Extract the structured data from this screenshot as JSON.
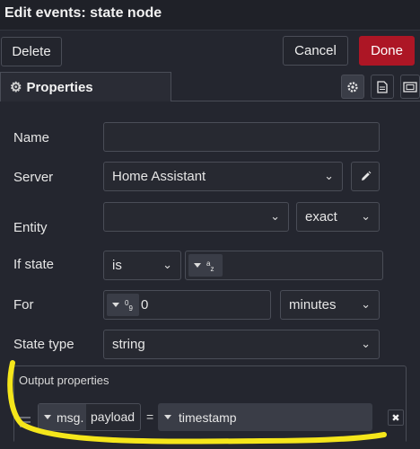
{
  "dialog": {
    "title": "Edit events: state node"
  },
  "actions": {
    "delete_label": "Delete",
    "cancel_label": "Cancel",
    "done_label": "Done",
    "done_color": "#ad1625"
  },
  "tabs": {
    "properties_label": "Properties",
    "icons": [
      "gear-icon",
      "document-icon",
      "frame-icon"
    ]
  },
  "form": {
    "name": {
      "label": "Name",
      "value": ""
    },
    "server": {
      "label": "Server",
      "value": "Home Assistant"
    },
    "entity": {
      "label": "Entity",
      "value": "",
      "match_mode": "exact"
    },
    "if_state": {
      "label": "If state",
      "operator": "is",
      "type_glyph": "a",
      "type_glyph_sub": "z",
      "value": ""
    },
    "for": {
      "label": "For",
      "type_glyph": "0",
      "type_glyph_sub": "9",
      "value": "0",
      "unit": "minutes"
    },
    "state_type": {
      "label": "State type",
      "value": "string"
    }
  },
  "output_properties": {
    "header": "Output properties",
    "rows": [
      {
        "prefix": "msg.",
        "property": "payload",
        "operator": "=",
        "value": "timestamp"
      }
    ]
  },
  "annotation": {
    "color": "#f5e61b"
  }
}
